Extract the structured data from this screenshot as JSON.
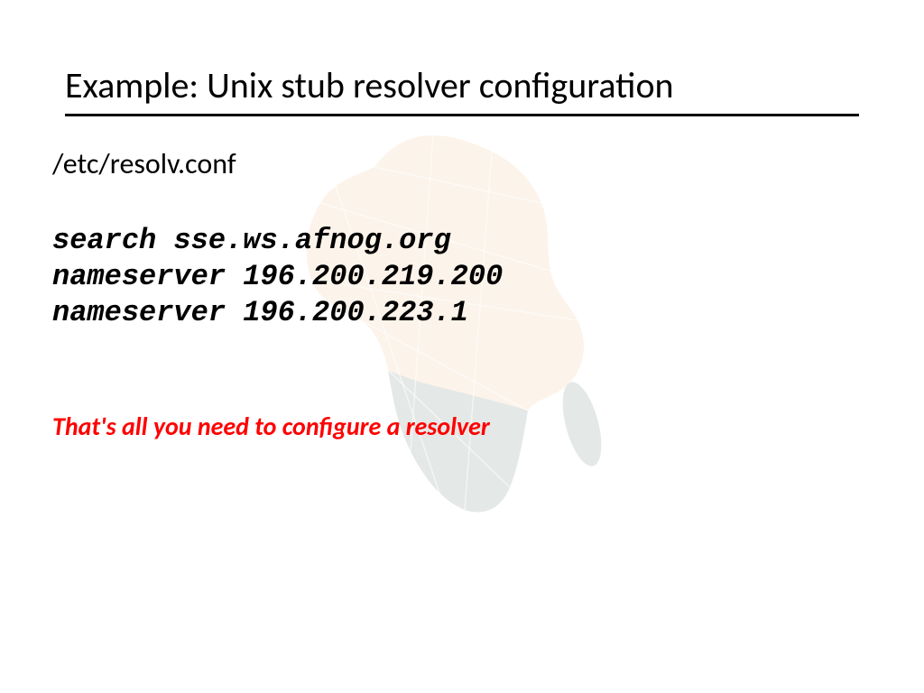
{
  "title": "Example: Unix stub resolver configuration",
  "filepath": "/etc/resolv.conf",
  "config": {
    "line1": "search sse.ws.afnog.org",
    "line2": "nameserver 196.200.219.200",
    "line3": "nameserver 196.200.223.1"
  },
  "note": "That's all you need to configure a resolver"
}
